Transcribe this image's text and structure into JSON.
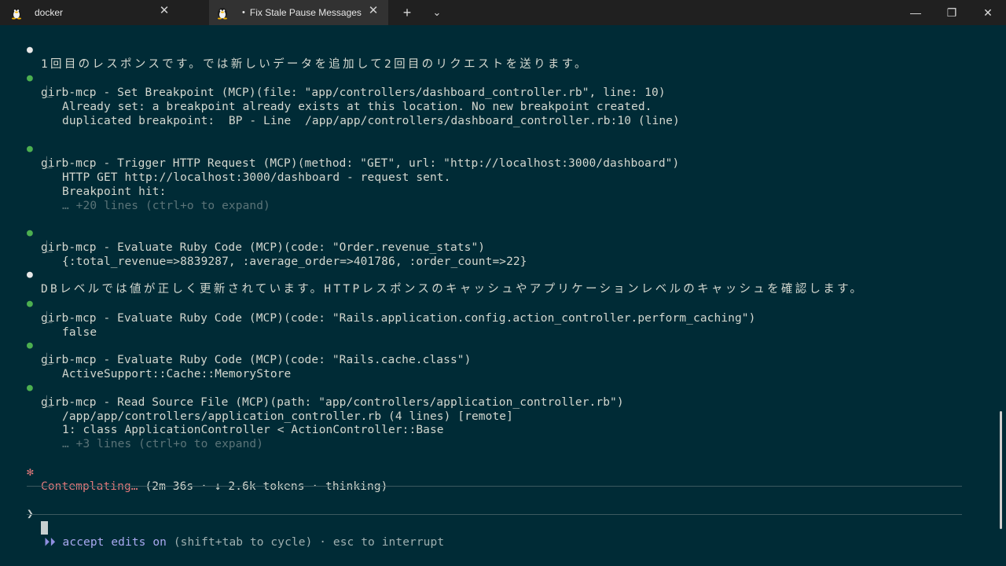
{
  "tabs": [
    {
      "label": "docker",
      "icon": "penguin-icon",
      "active": false
    },
    {
      "label": "Fix Stale Pause Messages",
      "icon": "penguin-icon",
      "active": true,
      "modified_marker": "•"
    }
  ],
  "tab_actions": {
    "new_tab": "+",
    "dropdown": "⌄"
  },
  "window_controls": {
    "minimize": "—",
    "restore": "❐",
    "close": "✕"
  },
  "terminal": {
    "lines": [
      {
        "kind": "msg",
        "text": "1回目のレスポンスです。では新しいデータを追加して2回目のリクエストを送ります。"
      },
      {
        "kind": "tool",
        "text": "girb-mcp - Set Breakpoint (MCP)(file: \"app/controllers/dashboard_controller.rb\", line: 10)"
      },
      {
        "kind": "result",
        "text": "Already set: a breakpoint already exists at this location. No new breakpoint created."
      },
      {
        "kind": "plain",
        "text": "duplicated breakpoint:  BP - Line  /app/app/controllers/dashboard_controller.rb:10 (line)"
      },
      {
        "kind": "tool",
        "text": "girb-mcp - Trigger HTTP Request (MCP)(method: \"GET\", url: \"http://localhost:3000/dashboard\")"
      },
      {
        "kind": "result",
        "text": "HTTP GET http://localhost:3000/dashboard - request sent."
      },
      {
        "kind": "plain",
        "text": "Breakpoint hit:"
      },
      {
        "kind": "dim",
        "text": "… +20 lines (ctrl+o to expand)"
      },
      {
        "kind": "tool",
        "text": "girb-mcp - Evaluate Ruby Code (MCP)(code: \"Order.revenue_stats\")"
      },
      {
        "kind": "result",
        "text": "{:total_revenue=>8839287, :average_order=>401786, :order_count=>22}"
      },
      {
        "kind": "msg",
        "text": "DBレベルでは値が正しく更新されています。HTTPレスポンスのキャッシュやアプリケーションレベルのキャッシュを確認します。"
      },
      {
        "kind": "tool",
        "text": "girb-mcp - Evaluate Ruby Code (MCP)(code: \"Rails.application.config.action_controller.perform_caching\")"
      },
      {
        "kind": "result",
        "text": "false"
      },
      {
        "kind": "tool",
        "text": "girb-mcp - Evaluate Ruby Code (MCP)(code: \"Rails.cache.class\")"
      },
      {
        "kind": "result",
        "text": "ActiveSupport::Cache::MemoryStore"
      },
      {
        "kind": "tool",
        "text": "girb-mcp - Read Source File (MCP)(path: \"app/controllers/application_controller.rb\")"
      },
      {
        "kind": "result",
        "text": "/app/app/controllers/application_controller.rb (4 lines) [remote]"
      },
      {
        "kind": "plain",
        "text": "1: class ApplicationController < ActionController::Base"
      },
      {
        "kind": "dim",
        "text": "… +3 lines (ctrl+o to expand)"
      }
    ],
    "status": {
      "spinner": "✻",
      "label": "Contemplating…",
      "detail": " (2m 36s · ↓ 2.6k tokens · thinking)"
    },
    "prompt": {
      "caret": "❯"
    },
    "footer": {
      "arrows": "⏵⏵",
      "mode": " accept edits on",
      "hint": " (shift+tab to cycle) · esc to interrupt"
    }
  },
  "colors": {
    "terminal_bg": "#002b36",
    "tool_bullet": "#4caf50",
    "spinner": "#e0787a",
    "mode": "#a9a9f0"
  }
}
